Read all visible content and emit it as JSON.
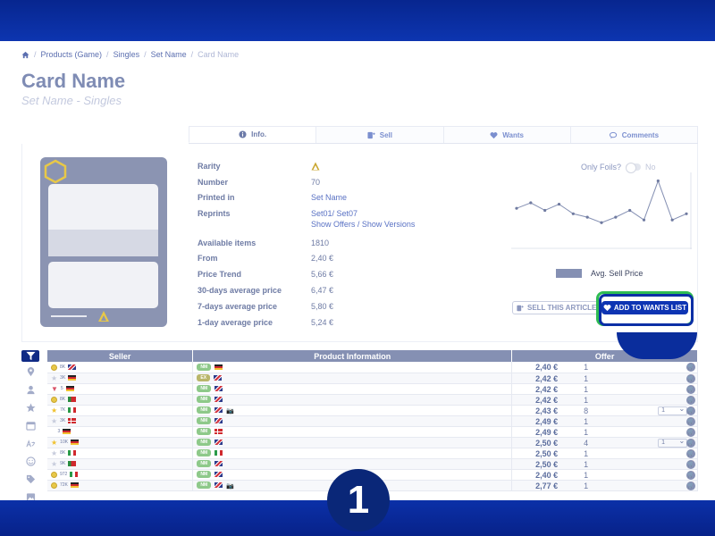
{
  "breadcrumb": {
    "items": [
      "Products (Game)",
      "Singles",
      "Set Name"
    ],
    "current": "Card Name"
  },
  "title": "Card Name",
  "subtitle": "Set Name - Singles",
  "tabs": [
    {
      "label": "Info.",
      "icon": "info-icon"
    },
    {
      "label": "Sell",
      "icon": "sell-icon"
    },
    {
      "label": "Wants",
      "icon": "heart-icon"
    },
    {
      "label": "Comments",
      "icon": "comments-icon"
    }
  ],
  "attributes": {
    "rarity": {
      "label": "Rarity"
    },
    "number": {
      "label": "Number",
      "value": "70"
    },
    "printed_in": {
      "label": "Printed in",
      "value": "Set Name"
    },
    "reprints": {
      "label": "Reprints",
      "value": "Set01/ Set07",
      "link": "Show Offers / Show Versions"
    },
    "available": {
      "label": "Available items",
      "value": "1810"
    },
    "from": {
      "label": "From",
      "value": "2,40 €"
    },
    "price_trend": {
      "label": "Price Trend",
      "value": "5,66 €"
    },
    "avg30": {
      "label": "30-days average price",
      "value": "6,47 €"
    },
    "avg7": {
      "label": "7-days average price",
      "value": "5,80 €"
    },
    "avg1": {
      "label": "1-day average price",
      "value": "5,24 €"
    }
  },
  "foils": {
    "label": "Only Foils?",
    "value": "No"
  },
  "chart_data": {
    "type": "line",
    "series": [
      {
        "name": "Avg. Sell Price",
        "values": [
          5.2,
          6.0,
          4.9,
          5.8,
          4.4,
          3.9,
          3.1,
          3.9,
          4.9,
          3.5,
          9.2,
          3.5,
          4.4
        ]
      }
    ],
    "legend": "Avg. Sell Price",
    "color": "#8590b3"
  },
  "buttons": {
    "sell": "SELL THIS ARTICLE",
    "wants": "ADD TO WANTS LIST"
  },
  "table": {
    "headers": [
      "Seller",
      "Product Information",
      "Offer"
    ],
    "rows": [
      {
        "badge": "gold",
        "sales": "8K",
        "flag": "gb",
        "cond": "NM",
        "lang": "de",
        "photo": false,
        "price": "2,40 €",
        "qty": "1",
        "select": ""
      },
      {
        "badge": "star",
        "sales": "3K",
        "flag": "de",
        "cond": "EX",
        "lang": "gb",
        "photo": false,
        "price": "2,42 €",
        "qty": "1",
        "select": ""
      },
      {
        "badge": "heart",
        "sales": "5",
        "flag": "de",
        "cond": "NM",
        "lang": "gb",
        "photo": false,
        "price": "2,42 €",
        "qty": "1",
        "select": ""
      },
      {
        "badge": "gold",
        "sales": "8K",
        "flag": "pt",
        "cond": "NM",
        "lang": "gb",
        "photo": false,
        "price": "2,42 €",
        "qty": "1",
        "select": ""
      },
      {
        "badge": "goldstar",
        "sales": "7K",
        "flag": "it",
        "cond": "NM",
        "lang": "gb",
        "photo": true,
        "price": "2,43 €",
        "qty": "8",
        "select": "1"
      },
      {
        "badge": "star",
        "sales": "3K",
        "flag": "dk",
        "cond": "NM",
        "lang": "gb",
        "photo": false,
        "price": "2,49 €",
        "qty": "1",
        "select": ""
      },
      {
        "badge": "none",
        "sales": "3",
        "flag": "de",
        "cond": "NM",
        "lang": "dk",
        "photo": false,
        "price": "2,49 €",
        "qty": "1",
        "select": ""
      },
      {
        "badge": "goldstar",
        "sales": "10K",
        "flag": "de",
        "cond": "NM",
        "lang": "gb",
        "photo": false,
        "price": "2,50 €",
        "qty": "4",
        "select": "1"
      },
      {
        "badge": "star",
        "sales": "8K",
        "flag": "it",
        "cond": "NM",
        "lang": "it",
        "photo": false,
        "price": "2,50 €",
        "qty": "1",
        "select": ""
      },
      {
        "badge": "star",
        "sales": "9K",
        "flag": "pt",
        "cond": "NM",
        "lang": "gb",
        "photo": false,
        "price": "2,50 €",
        "qty": "1",
        "select": ""
      },
      {
        "badge": "gold",
        "sales": "972",
        "flag": "it",
        "cond": "NM",
        "lang": "gb",
        "photo": false,
        "price": "2,40 €",
        "qty": "1",
        "select": ""
      },
      {
        "badge": "gold",
        "sales": "72K",
        "flag": "de",
        "cond": "NM",
        "lang": "gb",
        "photo": true,
        "price": "2,77 €",
        "qty": "1",
        "select": ""
      }
    ]
  },
  "step_badge": "1"
}
